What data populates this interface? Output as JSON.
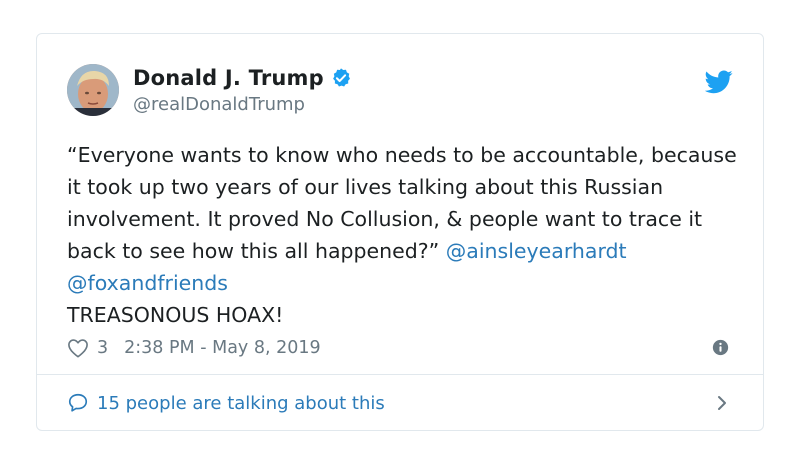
{
  "tweet": {
    "display_name": "Donald J. Trump",
    "handle": "@realDonaldTrump",
    "text_body": "“Everyone wants to know who needs to be accountable, because it took up two years of our lives talking about this Russian involvement. It proved No Collusion, & people want to trace it back to see how this all happened?” ",
    "mention_1": "@ainsleyearhardt",
    "mention_2": "@foxandfriends",
    "text_tail": "TREASONOUS HOAX!",
    "like_count": "3",
    "timestamp": "2:38 PM - May 8, 2019",
    "talking_about": "15 people are talking about this"
  },
  "colors": {
    "link": "#2b7bb9",
    "meta": "#697882",
    "verified": "#1da1f2",
    "twitter_bird": "#1da1f2"
  },
  "icons": [
    "verified-badge-icon",
    "twitter-bird-icon",
    "heart-icon",
    "info-icon",
    "speech-bubble-icon",
    "chevron-right-icon"
  ]
}
